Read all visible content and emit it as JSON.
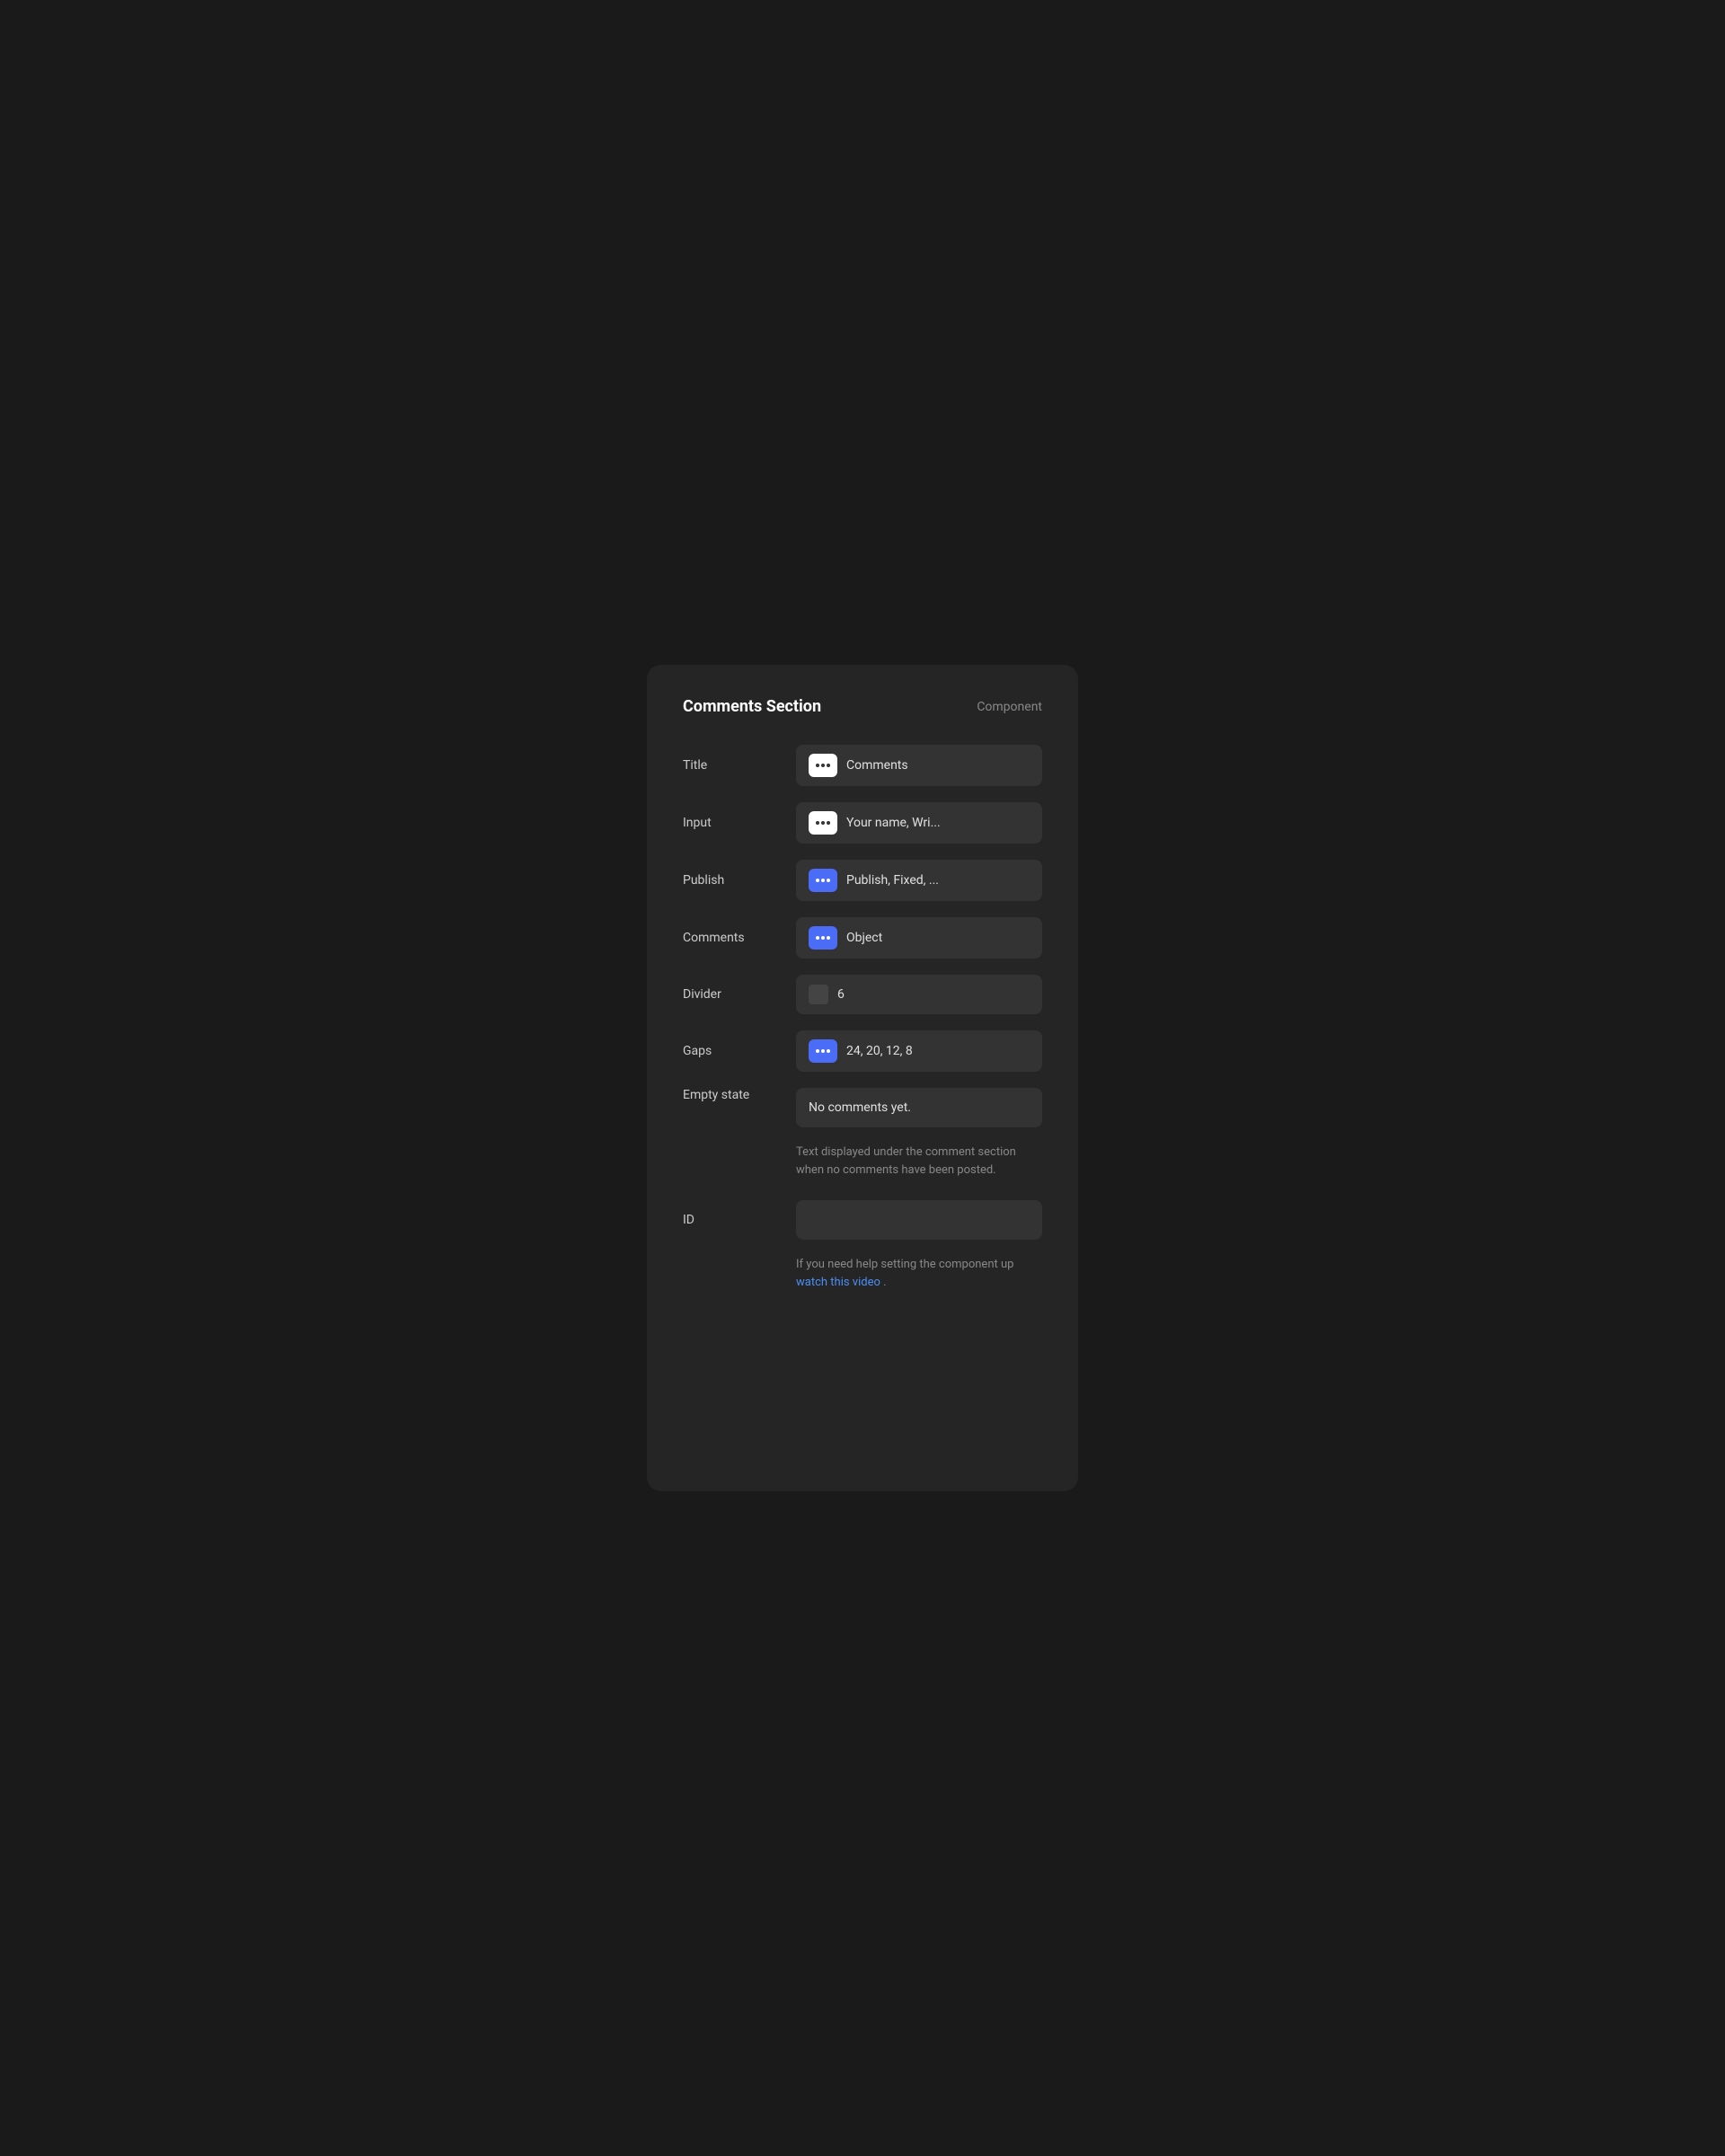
{
  "panel": {
    "title": "Comments Section",
    "type": "Component"
  },
  "fields": [
    {
      "id": "title",
      "label": "Title",
      "badge_type": "white",
      "value": "Comments",
      "icon": "dots"
    },
    {
      "id": "input",
      "label": "Input",
      "badge_type": "white",
      "value": "Your name, Wri...",
      "icon": "dots"
    },
    {
      "id": "publish",
      "label": "Publish",
      "badge_type": "blue",
      "value": "Publish, Fixed, ...",
      "icon": "dots"
    },
    {
      "id": "comments",
      "label": "Comments",
      "badge_type": "blue",
      "value": "Object",
      "icon": "dots"
    },
    {
      "id": "divider",
      "label": "Divider",
      "badge_type": "checkbox",
      "value": "6",
      "icon": "checkbox"
    },
    {
      "id": "gaps",
      "label": "Gaps",
      "badge_type": "blue",
      "value": "24, 20, 12, 8",
      "icon": "dots"
    }
  ],
  "empty_state": {
    "label": "Empty state",
    "value": "No comments yet.",
    "helper": "Text displayed under the comment section when no comments have been posted."
  },
  "id_field": {
    "label": "ID",
    "value": "",
    "helper_prefix": "If you need help setting the component up",
    "link_text": "watch this video",
    "helper_suffix": "."
  }
}
